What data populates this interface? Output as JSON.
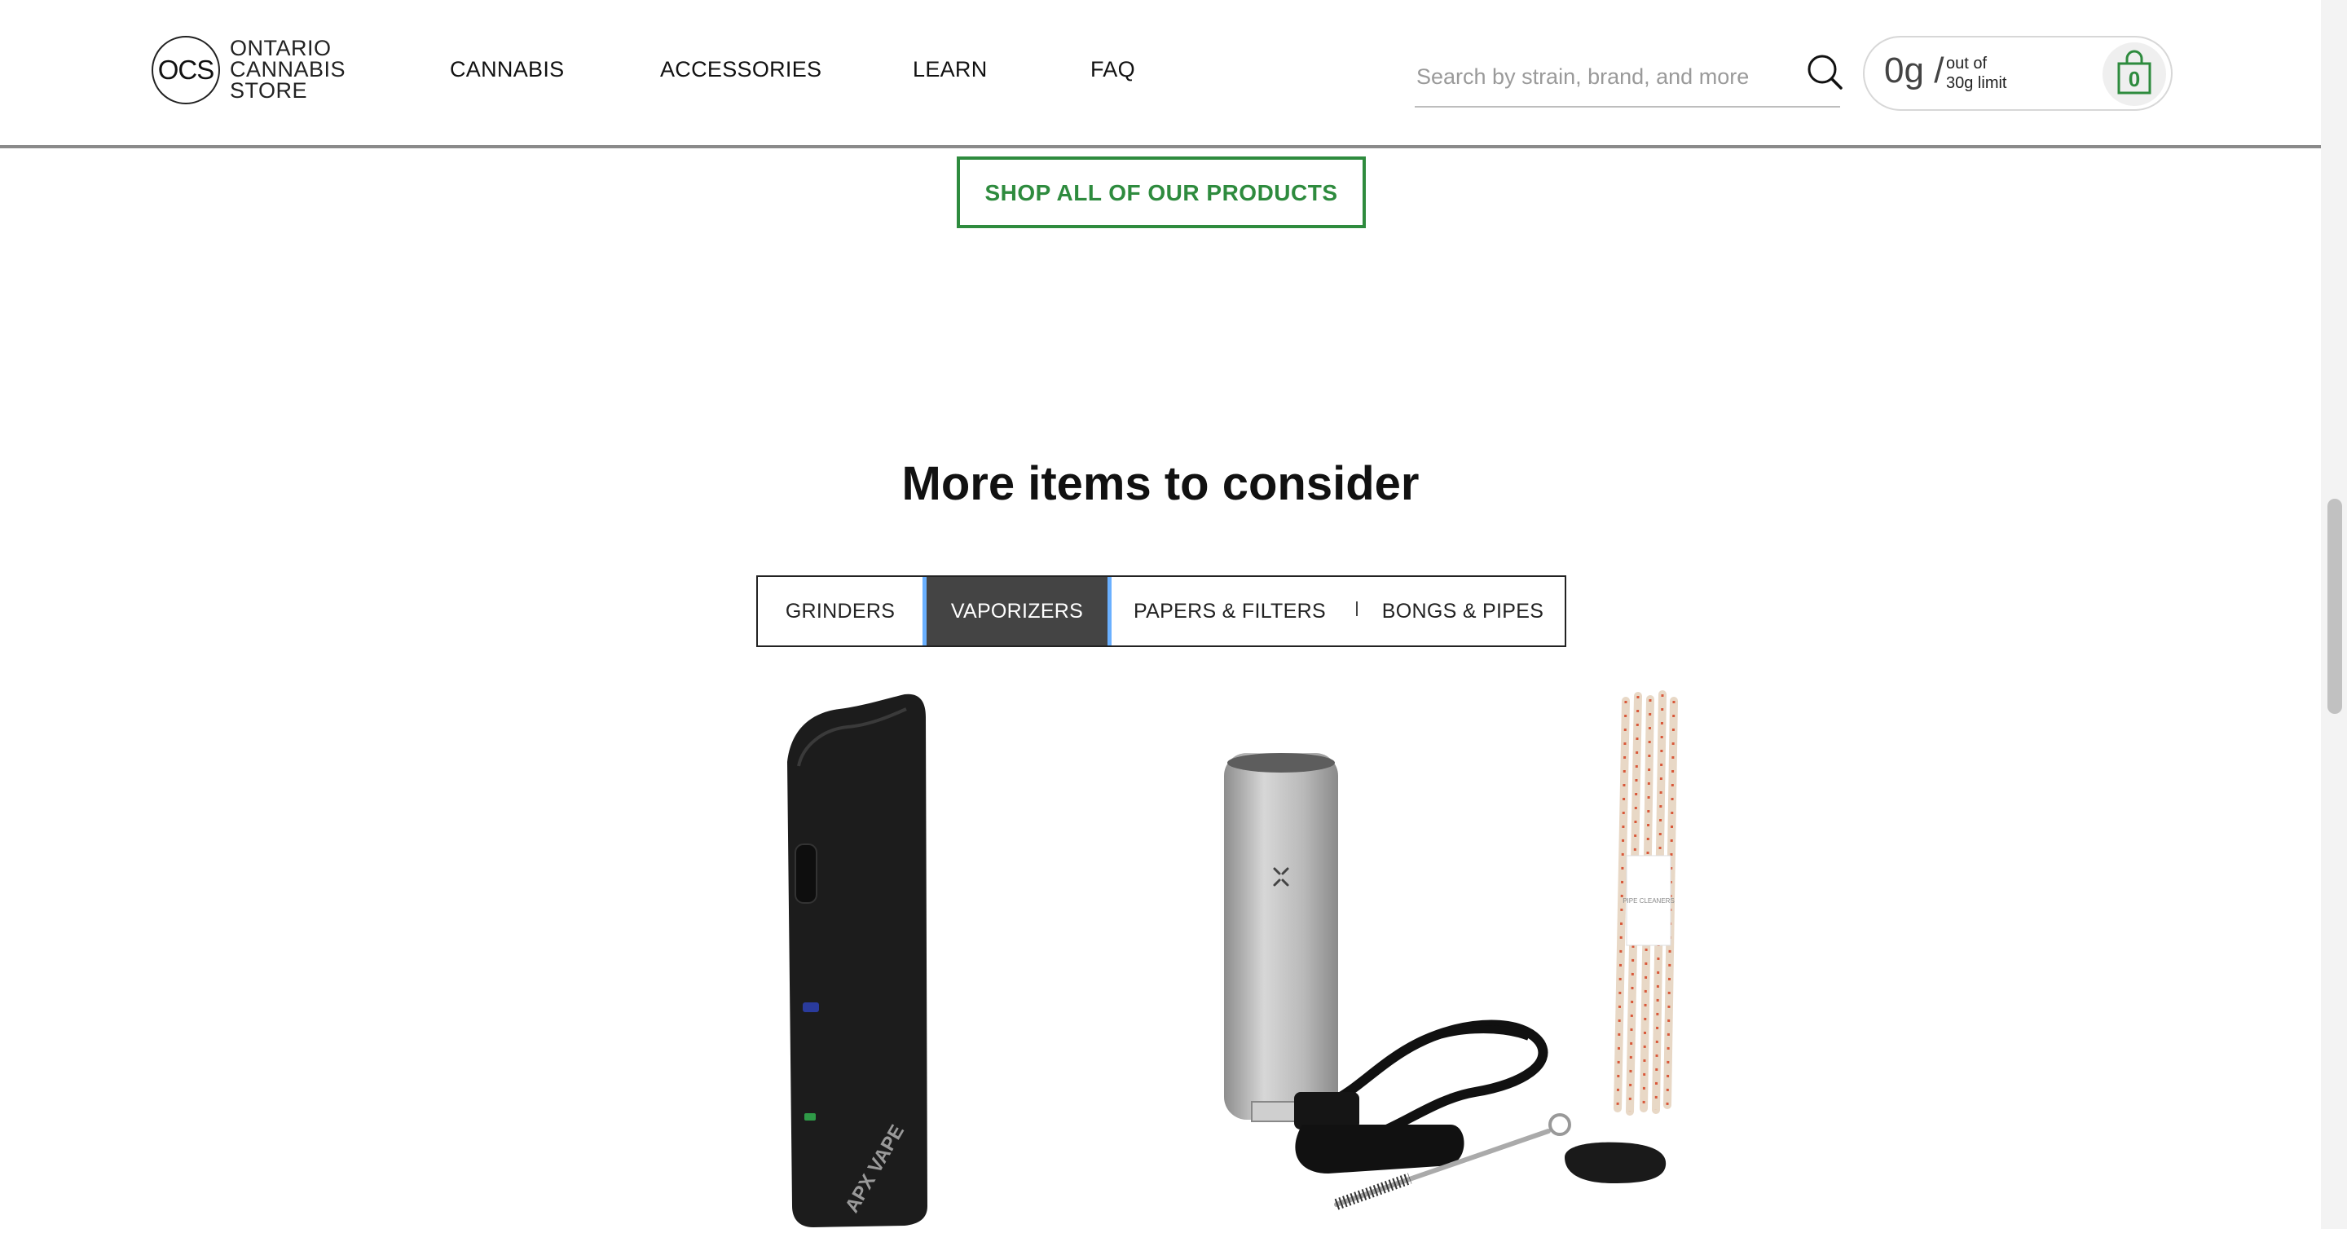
{
  "header": {
    "logo": {
      "mark": "OCS",
      "words": [
        "ONTARIO",
        "CANNABIS",
        "STORE"
      ]
    },
    "nav": [
      {
        "label": "CANNABIS"
      },
      {
        "label": "ACCESSORIES"
      },
      {
        "label": "LEARN"
      },
      {
        "label": "FAQ"
      }
    ],
    "search": {
      "placeholder": "Search by strain, brand, and more",
      "value": "",
      "icon": "search-icon"
    },
    "cart": {
      "grams": "0g",
      "slash": "/",
      "limit_line1": "out of",
      "limit_line2": "30g limit",
      "count": "0",
      "icon": "shopping-bag-icon",
      "accent": "#2e8b3e"
    }
  },
  "cta": {
    "shop_all_label": "SHOP ALL OF OUR PRODUCTS",
    "color": "#2e8b3e"
  },
  "section": {
    "title": "More items to consider",
    "tabs": [
      {
        "label": "GRINDERS",
        "active": false
      },
      {
        "label": "VAPORIZERS",
        "active": true
      },
      {
        "label": "PAPERS & FILTERS",
        "active": false
      },
      {
        "label": "BONGS & PIPES",
        "active": false
      }
    ],
    "tab_separator": "|"
  },
  "products": [
    {
      "image": "black-vaporizer-image",
      "brand_mark": "APX VAPE"
    },
    {
      "image": "silver-vaporizer-kit-image",
      "package_text": "PIPE CLEANERS"
    }
  ]
}
